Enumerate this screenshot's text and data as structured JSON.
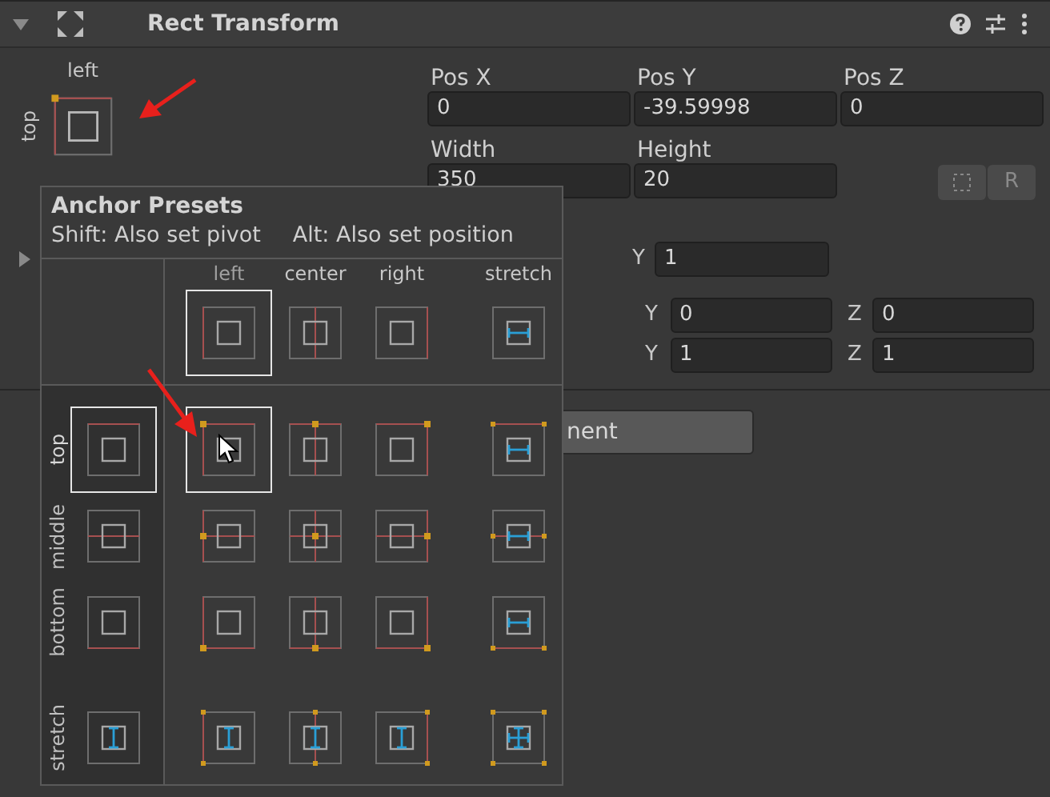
{
  "component": {
    "title": "Rect Transform",
    "expanded": true
  },
  "anchor_widget": {
    "h_label": "left",
    "v_label": "top"
  },
  "position_fields": [
    {
      "label": "Pos X",
      "value": "0"
    },
    {
      "label": "Pos Y",
      "value": "-39.59998"
    },
    {
      "label": "Pos Z",
      "value": "0"
    }
  ],
  "size_fields": [
    {
      "label": "Width",
      "value": "350"
    },
    {
      "label": "Height",
      "value": "20"
    }
  ],
  "raw_edit_symbol": "R",
  "anchors_foldout": {
    "expanded": false
  },
  "pivot": [
    {
      "axis": "Y",
      "value": "1"
    }
  ],
  "rotation": [
    {
      "axis": "Y",
      "value": "0"
    },
    {
      "axis": "Z",
      "value": "0"
    }
  ],
  "scale": [
    {
      "axis": "Y",
      "value": "1"
    },
    {
      "axis": "Z",
      "value": "1"
    }
  ],
  "add_button": {
    "label": "nent"
  },
  "popup": {
    "title": "Anchor Presets",
    "hint_pivot": "Shift: Also set pivot",
    "hint_position": "Alt: Also set position",
    "columns": [
      {
        "label": "left",
        "kind": "left",
        "selected": true
      },
      {
        "label": "center",
        "kind": "center",
        "selected": false
      },
      {
        "label": "right",
        "kind": "right",
        "selected": false
      },
      {
        "label": "stretch",
        "kind": "stretch",
        "selected": false
      }
    ],
    "rows": [
      {
        "label": "top",
        "kind": "top",
        "selected": true,
        "cells": [
          {
            "selected": true
          },
          {
            "selected": false
          },
          {
            "selected": false
          },
          {
            "selected": false
          }
        ]
      },
      {
        "label": "middle",
        "kind": "middle",
        "selected": false,
        "cells": [
          {
            "selected": false
          },
          {
            "selected": false
          },
          {
            "selected": false
          },
          {
            "selected": false
          }
        ]
      },
      {
        "label": "bottom",
        "kind": "bottom",
        "selected": false,
        "cells": [
          {
            "selected": false
          },
          {
            "selected": false
          },
          {
            "selected": false
          },
          {
            "selected": false
          }
        ]
      },
      {
        "label": "stretch",
        "kind": "stretch",
        "selected": false,
        "cells": [
          {
            "selected": false
          },
          {
            "selected": false
          },
          {
            "selected": false
          },
          {
            "selected": false
          }
        ]
      }
    ]
  }
}
